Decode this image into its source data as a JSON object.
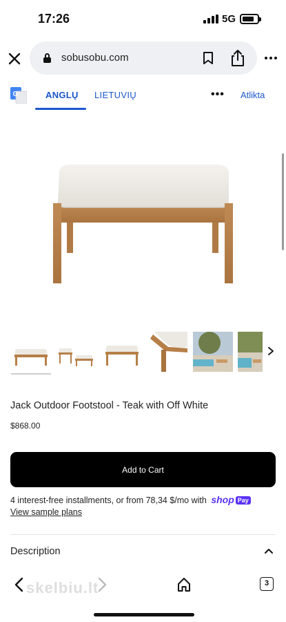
{
  "status_bar": {
    "time": "17:26",
    "network": "5G"
  },
  "browser": {
    "url": "sobusobu.com"
  },
  "translate_bar": {
    "tab_source": "ANGLŲ",
    "tab_target": "LIETUVIŲ",
    "more": "•••",
    "done": "Atlikta"
  },
  "product": {
    "title": "Jack Outdoor Footstool - Teak with Off White",
    "price": "$868.00",
    "add_to_cart": "Add to Cart",
    "installments_text": "4 interest-free installments, or from 78,34 $/mo with",
    "shop_pay_logo": "shop",
    "shop_pay_badge": "Pay",
    "sample_plans_link": "View sample plans",
    "description_label": "Description"
  },
  "bottom_bar": {
    "tab_count": "3",
    "watermark": "skelbiu.lt"
  },
  "colors": {
    "accent": "#1a56c9",
    "shop_pay": "#5a31f4",
    "cart_button": "#000000"
  }
}
